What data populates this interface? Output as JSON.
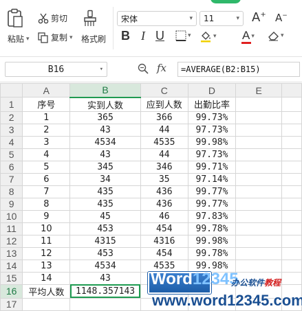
{
  "ribbon": {
    "paste_label": "粘贴",
    "cut_label": "剪切",
    "copy_label": "复制",
    "format_painter_label": "格式刷",
    "font_name": "宋体",
    "font_size": "11",
    "accent_color": "#2fb86a",
    "font_color_bar": "#e02020"
  },
  "formula_bar": {
    "name_box": "B16",
    "fx_label": "fx",
    "formula": "=AVERAGE(B2:B15)"
  },
  "sheet": {
    "columns": [
      "A",
      "B",
      "C",
      "D",
      "E"
    ],
    "active_column": "B",
    "rows": [
      {
        "num": "1",
        "a": "序号",
        "b": "实到人数",
        "c": "应到人数",
        "d": "出勤比率"
      },
      {
        "num": "2",
        "a": "1",
        "b": "365",
        "c": "366",
        "d": "99.73%"
      },
      {
        "num": "3",
        "a": "2",
        "b": "43",
        "c": "44",
        "d": "97.73%"
      },
      {
        "num": "4",
        "a": "3",
        "b": "4534",
        "c": "4535",
        "d": "99.98%"
      },
      {
        "num": "5",
        "a": "4",
        "b": "43",
        "c": "44",
        "d": "97.73%"
      },
      {
        "num": "6",
        "a": "5",
        "b": "345",
        "c": "346",
        "d": "99.71%"
      },
      {
        "num": "7",
        "a": "6",
        "b": "34",
        "c": "35",
        "d": "97.14%"
      },
      {
        "num": "8",
        "a": "7",
        "b": "435",
        "c": "436",
        "d": "99.77%"
      },
      {
        "num": "9",
        "a": "8",
        "b": "435",
        "c": "436",
        "d": "99.77%"
      },
      {
        "num": "10",
        "a": "9",
        "b": "45",
        "c": "46",
        "d": "97.83%"
      },
      {
        "num": "11",
        "a": "10",
        "b": "453",
        "c": "454",
        "d": "99.78%"
      },
      {
        "num": "12",
        "a": "11",
        "b": "4315",
        "c": "4316",
        "d": "99.98%"
      },
      {
        "num": "13",
        "a": "12",
        "b": "453",
        "c": "454",
        "d": "99.78%"
      },
      {
        "num": "14",
        "a": "13",
        "b": "4534",
        "c": "4535",
        "d": "99.98%"
      },
      {
        "num": "15",
        "a": "14",
        "b": "43",
        "c": "",
        "d": ""
      },
      {
        "num": "16",
        "a": "平均人数",
        "b": "1148.357143",
        "c": "",
        "d": ""
      },
      {
        "num": "17",
        "a": "",
        "b": "",
        "c": "",
        "d": ""
      }
    ]
  },
  "watermark": {
    "brand_word": "Word",
    "brand_num": "12345",
    "tagline_a": "办公软件",
    "tagline_b": "教程",
    "url": "www.word12345.com"
  }
}
